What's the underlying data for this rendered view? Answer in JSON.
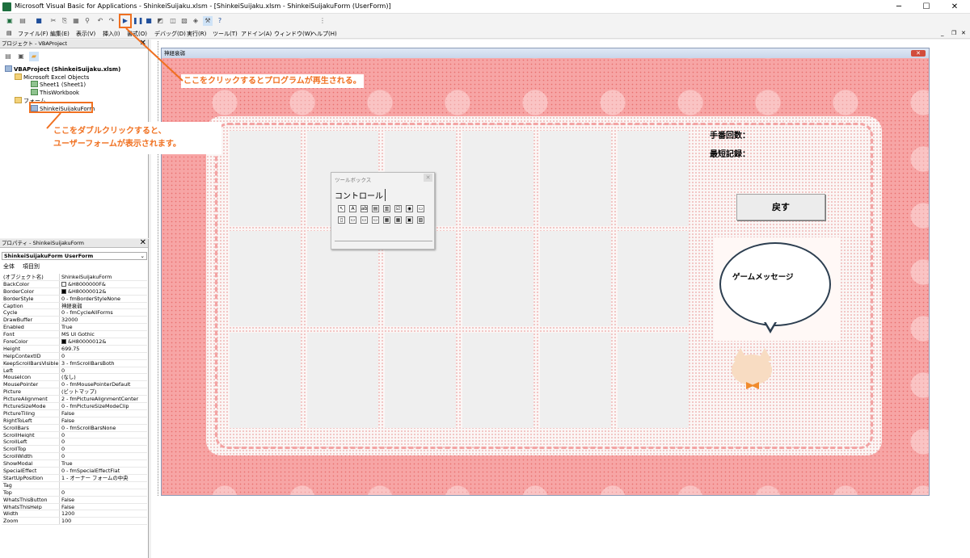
{
  "window": {
    "title": "Microsoft Visual Basic for Applications - ShinkeiSuijaku.xlsm - [ShinkeiSuijaku.xlsm - ShinkeiSuijakuForm (UserForm)]",
    "min": "─",
    "max": "☐",
    "close": "✕"
  },
  "menu": [
    "ファイル(F)",
    "編集(E)",
    "表示(V)",
    "挿入(I)",
    "書式(O)",
    "デバッグ(D)",
    "実行(R)",
    "ツール(T)",
    "アドイン(A)",
    "ウィンドウ(W)",
    "ヘルプ(H)"
  ],
  "project": {
    "title": "プロジェクト - VBAProject",
    "root": "VBAProject (ShinkeiSuijaku.xlsm)",
    "excel_objects": "Microsoft Excel Objects",
    "sheet1": "Sheet1 (Sheet1)",
    "workbook": "ThisWorkbook",
    "forms": "フォーム",
    "form": "ShinkeiSuijakuForm"
  },
  "properties": {
    "title": "プロパティ - ShinkeiSuijakuForm",
    "object": "ShinkeiSuijakuForm UserForm",
    "tab_all": "全体",
    "tab_cat": "項目別",
    "rows": [
      [
        "(オブジェクト名)",
        "ShinkeiSuijakuForm"
      ],
      [
        "BackColor",
        "&H8000000F&"
      ],
      [
        "BorderColor",
        "&H80000012&"
      ],
      [
        "BorderStyle",
        "0 - fmBorderStyleNone"
      ],
      [
        "Caption",
        "神経衰弱"
      ],
      [
        "Cycle",
        "0 - fmCycleAllForms"
      ],
      [
        "DrawBuffer",
        "32000"
      ],
      [
        "Enabled",
        "True"
      ],
      [
        "Font",
        "MS UI Gothic"
      ],
      [
        "ForeColor",
        "&H80000012&"
      ],
      [
        "Height",
        "699.75"
      ],
      [
        "HelpContextID",
        "0"
      ],
      [
        "KeepScrollBarsVisible",
        "3 - fmScrollBarsBoth"
      ],
      [
        "Left",
        "0"
      ],
      [
        "MouseIcon",
        "(なし)"
      ],
      [
        "MousePointer",
        "0 - fmMousePointerDefault"
      ],
      [
        "Picture",
        "(ビットマップ)"
      ],
      [
        "PictureAlignment",
        "2 - fmPictureAlignmentCenter"
      ],
      [
        "PictureSizeMode",
        "0 - fmPictureSizeModeClip"
      ],
      [
        "PictureTiling",
        "False"
      ],
      [
        "RightToLeft",
        "False"
      ],
      [
        "ScrollBars",
        "0 - fmScrollBarsNone"
      ],
      [
        "ScrollHeight",
        "0"
      ],
      [
        "ScrollLeft",
        "0"
      ],
      [
        "ScrollTop",
        "0"
      ],
      [
        "ScrollWidth",
        "0"
      ],
      [
        "ShowModal",
        "True"
      ],
      [
        "SpecialEffect",
        "0 - fmSpecialEffectFlat"
      ],
      [
        "StartUpPosition",
        "1 - オーナー フォームの中央"
      ],
      [
        "Tag",
        ""
      ],
      [
        "Top",
        "0"
      ],
      [
        "WhatsThisButton",
        "False"
      ],
      [
        "WhatsThisHelp",
        "False"
      ],
      [
        "Width",
        "1200"
      ],
      [
        "Zoom",
        "100"
      ]
    ]
  },
  "form": {
    "caption": "神経衰弱",
    "close": "✕",
    "moves_label": "手番回数：",
    "best_label": "最短記録：",
    "back_button": "戻す",
    "message": "ゲームメッセージ"
  },
  "toolbox": {
    "title": "ツールボックス",
    "tab": "コントロール"
  },
  "annotations": {
    "run": "ここをクリックするとプログラムが再生される。",
    "dblclick1": "ここをダブルクリックすると、",
    "dblclick2": "ユーザーフォームが表示されます。"
  },
  "colors": {
    "accent": "#f07020",
    "form_bg": "#f7a5a5"
  }
}
